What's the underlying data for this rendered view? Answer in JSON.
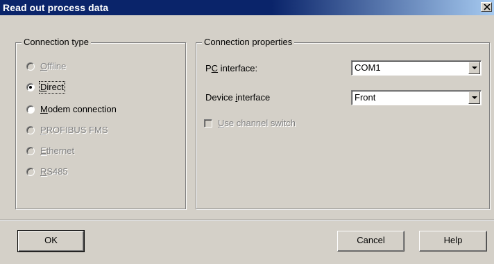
{
  "window": {
    "title": "Read out process data",
    "close_symbol": "×"
  },
  "connection_type": {
    "legend": "Connection type",
    "options": [
      {
        "hotkey": "O",
        "rest": "ffline",
        "enabled": false,
        "selected": false
      },
      {
        "hotkey": "D",
        "rest": "irect",
        "enabled": true,
        "selected": true
      },
      {
        "hotkey": "M",
        "rest": "odem connection",
        "enabled": true,
        "selected": false
      },
      {
        "hotkey": "P",
        "rest": "ROFIBUS FMS",
        "enabled": false,
        "selected": false
      },
      {
        "hotkey": "E",
        "rest": "thernet",
        "enabled": false,
        "selected": false
      },
      {
        "hotkey": "R",
        "rest": "S485",
        "enabled": false,
        "selected": false
      }
    ]
  },
  "connection_properties": {
    "legend": "Connection properties",
    "pc_interface": {
      "label_pre": "P",
      "label_hotkey": "C",
      "label_post": " interface:",
      "value": "COM1"
    },
    "device_interface": {
      "label_pre": "Device ",
      "label_hotkey": "i",
      "label_post": "nterface",
      "value": "Front"
    },
    "use_channel_switch": {
      "label_hotkey": "U",
      "label_rest": "se channel switch",
      "checked": false,
      "enabled": false
    }
  },
  "buttons": {
    "ok": "OK",
    "cancel": "Cancel",
    "help": "Help"
  }
}
